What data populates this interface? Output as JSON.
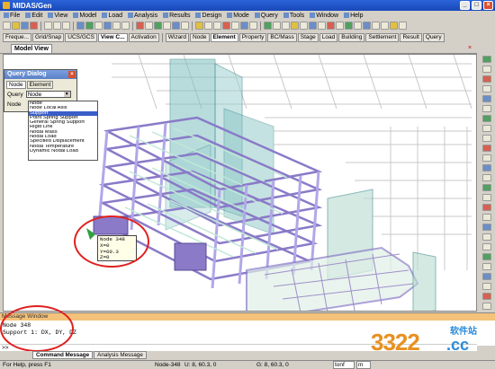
{
  "window": {
    "title": "MIDAS/Gen"
  },
  "menu": [
    "File",
    "Edit",
    "View",
    "Model",
    "Load",
    "Analysis",
    "Results",
    "Design",
    "Mode",
    "Query",
    "Tools",
    "Window",
    "Help"
  ],
  "tabs_left": [
    "Freque...",
    "Grid/Snap",
    "UCS/GCS",
    "View C...",
    "Activation"
  ],
  "tabs_right": [
    "Wizard",
    "Node",
    "Element",
    "Property",
    "BC/Mass",
    "Stage",
    "Load",
    "Building",
    "Settlement",
    "Result",
    "Query"
  ],
  "model_view": {
    "tab_label": "Model View"
  },
  "query_dialog": {
    "title": "Query Dialog",
    "tabs": [
      "Node",
      "Element"
    ],
    "query_label": "Query",
    "node_label": "Node",
    "query_value": "Node",
    "options": [
      "Node",
      "Node Local Axis",
      "Support",
      "Point Spring Support",
      "General Spring Support",
      "Rigid Link",
      "Nodal Mass",
      "Nodal Load",
      "Specified Displacement",
      "Nodal Temperature",
      "Dynamic Nodal Load"
    ],
    "selected_option": "Support"
  },
  "node_info": {
    "lines": [
      "Node 348",
      "X=0",
      "Y=60.3",
      "Z=0"
    ]
  },
  "message_window": {
    "title": "Message Window",
    "lines": [
      "Node 348",
      "Support 1: DX, DY, DZ"
    ],
    "prompt": ">>"
  },
  "message_tabs": [
    "Command Message",
    "Analysis Message"
  ],
  "status": {
    "help": "For Help, press F1",
    "node": "Node-348",
    "u": "U: 8, 60.3, 0",
    "g": "G: 8, 60.3, 0",
    "unit": "tonf",
    "length_unit": "m"
  },
  "watermark": {
    "number": "3322",
    "suffix": ".cc",
    "cn": "软件站"
  },
  "colors": {
    "title_bar": "#2a64d8",
    "message_header": "#f4c27a",
    "highlight_circle": "#e02020",
    "beam": "#9aa0e8",
    "slab": "#c8e8d0"
  }
}
